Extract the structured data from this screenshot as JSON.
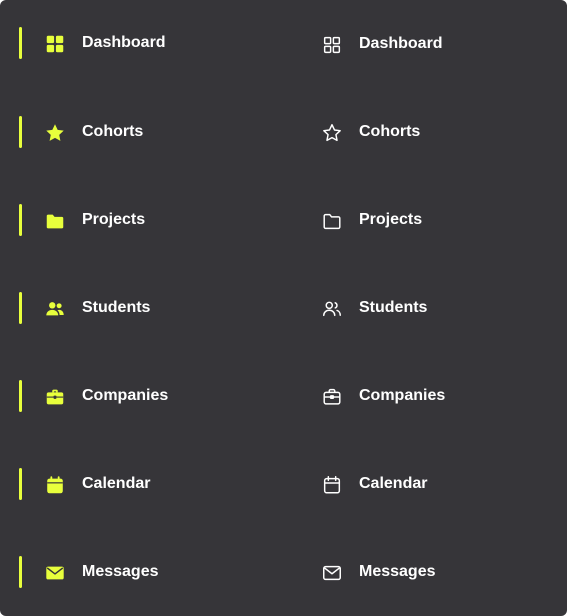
{
  "colors": {
    "panel_bg": "#363539",
    "accent": "#e8ff3c",
    "text": "#ffffff",
    "default_icon": "#ffffff"
  },
  "nav_active": {
    "items": [
      {
        "label": "Dashboard",
        "icon": "dashboard-grid-icon"
      },
      {
        "label": "Cohorts",
        "icon": "star-icon"
      },
      {
        "label": "Projects",
        "icon": "folder-icon"
      },
      {
        "label": "Students",
        "icon": "users-icon"
      },
      {
        "label": "Companies",
        "icon": "briefcase-icon"
      },
      {
        "label": "Calendar",
        "icon": "calendar-icon"
      },
      {
        "label": "Messages",
        "icon": "mail-icon"
      }
    ]
  },
  "nav_default": {
    "items": [
      {
        "label": "Dashboard",
        "icon": "dashboard-grid-icon"
      },
      {
        "label": "Cohorts",
        "icon": "star-icon"
      },
      {
        "label": "Projects",
        "icon": "folder-icon"
      },
      {
        "label": "Students",
        "icon": "users-icon"
      },
      {
        "label": "Companies",
        "icon": "briefcase-icon"
      },
      {
        "label": "Calendar",
        "icon": "calendar-icon"
      },
      {
        "label": "Messages",
        "icon": "mail-icon"
      }
    ]
  }
}
